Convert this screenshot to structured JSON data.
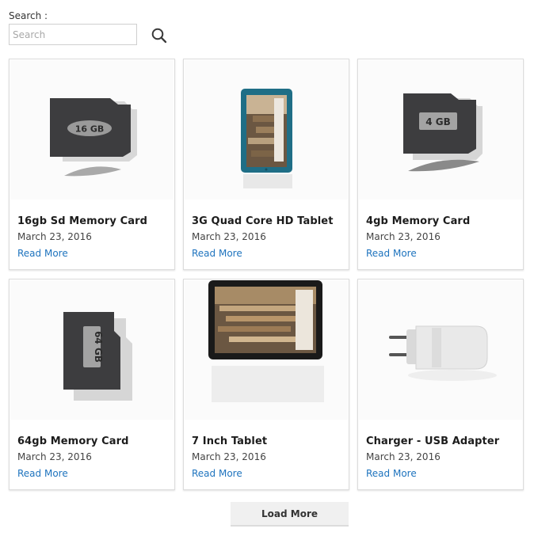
{
  "search": {
    "label": "Search :",
    "placeholder": "Search",
    "value": ""
  },
  "products": [
    {
      "title": "16gb Sd Memory Card",
      "date": "March 23, 2016",
      "read_more": "Read More",
      "image": "memory-card",
      "image_text": "16 GB"
    },
    {
      "title": "3G Quad Core HD Tablet",
      "date": "March 23, 2016",
      "read_more": "Read More",
      "image": "tablet-portrait"
    },
    {
      "title": "4gb Memory Card",
      "date": "March 23, 2016",
      "read_more": "Read More",
      "image": "memory-card",
      "image_text": "4 GB"
    },
    {
      "title": "64gb Memory Card",
      "date": "March 23, 2016",
      "read_more": "Read More",
      "image": "memory-card-vertical",
      "image_text": "64 GB"
    },
    {
      "title": "7 Inch Tablet",
      "date": "March 23, 2016",
      "read_more": "Read More",
      "image": "tablet-landscape"
    },
    {
      "title": "Charger - USB Adapter",
      "date": "March 23, 2016",
      "read_more": "Read More",
      "image": "usb-charger"
    }
  ],
  "load_more": {
    "label": "Load More"
  },
  "colors": {
    "link": "#1e73be",
    "card_border": "#dcdcdc",
    "tablet_teal": "#1f6e86"
  }
}
